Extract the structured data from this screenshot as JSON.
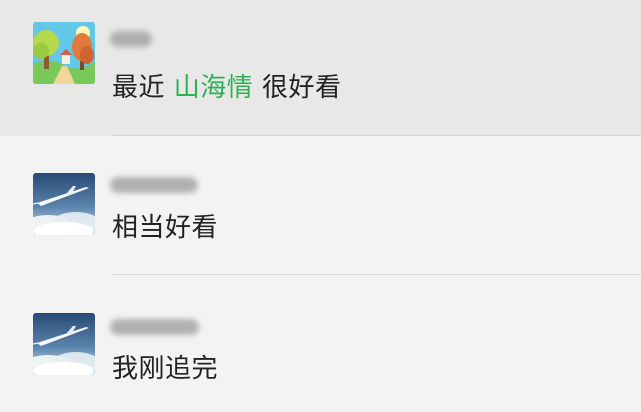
{
  "comments": [
    {
      "avatar_icon": "cartoon-landscape-avatar-icon",
      "name_hidden": true,
      "text_before": "最近 ",
      "link_text": "山海情",
      "text_after": " 很好看",
      "link_color": "#2eb251",
      "background": "#e8e8e8"
    },
    {
      "avatar_icon": "airplane-sky-avatar-icon",
      "name_hidden": true,
      "text": "相当好看",
      "background": "#f3f3f3"
    },
    {
      "avatar_icon": "airplane-sky-avatar-icon",
      "name_hidden": true,
      "text": "我刚追完",
      "background": "#f3f3f3"
    }
  ]
}
